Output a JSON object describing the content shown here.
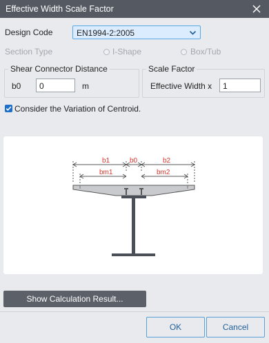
{
  "window": {
    "title": "Effective Width Scale Factor"
  },
  "design_code": {
    "label": "Design Code",
    "value": "EN1994-2:2005"
  },
  "section_type": {
    "label": "Section Type",
    "option_i": "I-Shape",
    "option_box": "Box/Tub"
  },
  "shear_connector": {
    "title": "Shear Connector Distance",
    "b0_label": "b0",
    "b0_value": "0",
    "unit": "m"
  },
  "scale_factor": {
    "title": "Scale Factor",
    "label": "Effective Width x",
    "value": "1"
  },
  "centroid": {
    "label": "Consider the Variation of Centroid.",
    "checked": true
  },
  "diagram": {
    "b1": "b1",
    "b0": "b0",
    "b2": "b2",
    "bm1": "bm1",
    "bm2": "bm2"
  },
  "buttons": {
    "calc": "Show Calculation Result...",
    "ok": "OK",
    "cancel": "Cancel"
  },
  "colors": {
    "titlebar": "#555a62",
    "accent": "#1e6fc7",
    "dimension_text": "#d9352c",
    "beam": "#4a4f57",
    "slab": "#c8cacd"
  }
}
